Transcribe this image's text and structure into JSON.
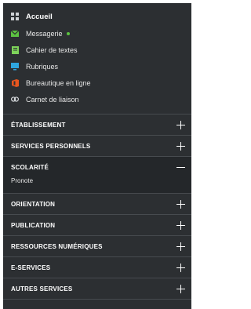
{
  "colors": {
    "panel_bg": "#2c2f32",
    "open_section_bg": "#24272a",
    "notification_dot": "#5cc341",
    "messagerie_icon": "#5cc341",
    "cahier_icon": "#7ed35a",
    "rubriques_icon": "#2ea6e0",
    "bureautique_icon": "#e8561f"
  },
  "links": [
    {
      "label": "Accueil",
      "icon": "grid-icon"
    },
    {
      "label": "Messagerie",
      "icon": "envelope-icon",
      "notification": true
    },
    {
      "label": "Cahier de textes",
      "icon": "notebook-icon"
    },
    {
      "label": "Rubriques",
      "icon": "monitor-icon"
    },
    {
      "label": "Bureautique en ligne",
      "icon": "office-icon"
    },
    {
      "label": "Carnet de liaison",
      "icon": "link-icon"
    }
  ],
  "sections": [
    {
      "label": "ÉTABLISSEMENT",
      "expanded": false
    },
    {
      "label": "SERVICES PERSONNELS",
      "expanded": false
    },
    {
      "label": "SCOLARITÉ",
      "expanded": true,
      "items": [
        "Pronote"
      ]
    },
    {
      "label": "ORIENTATION",
      "expanded": false
    },
    {
      "label": "PUBLICATION",
      "expanded": false
    },
    {
      "label": "RESSOURCES NUMÉRIQUES",
      "expanded": false
    },
    {
      "label": "E-SERVICES",
      "expanded": false
    },
    {
      "label": "AUTRES SERVICES",
      "expanded": false
    }
  ]
}
